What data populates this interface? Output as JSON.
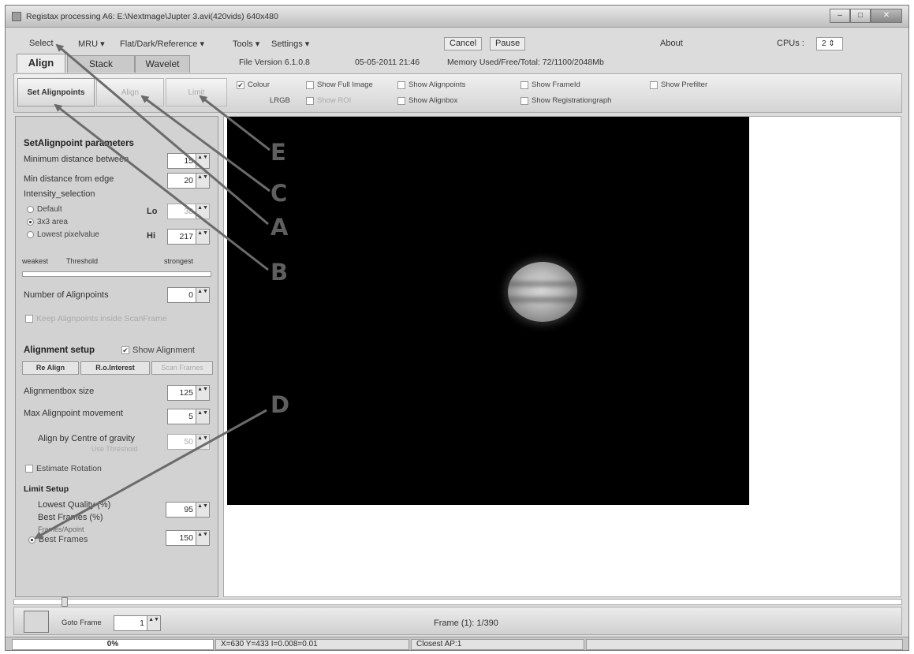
{
  "window": {
    "title": "Registax processing A6: E:\\Nextmage\\Jupter 3.avi(420vids) 640x480",
    "min": "–",
    "max": "□",
    "close": "✕"
  },
  "menu": {
    "select": "Select",
    "mru": "MRU ▾",
    "flat": "Flat/Dark/Reference ▾",
    "tools": "Tools ▾",
    "settings": "Settings ▾",
    "cancel": "Cancel",
    "pause": "Pause",
    "about": "About",
    "cpus_label": "CPUs :",
    "cpus_value": "2 ⇕"
  },
  "tabs": [
    "Align",
    "Stack",
    "Wavelet"
  ],
  "info": {
    "version": "File Version 6.1.0.8",
    "date": "05-05-2011 21:46",
    "memory": "Memory Used/Free/Total: 72/1100/2048Mb"
  },
  "toolbar": {
    "set_alignpoints": "Set Alignpoints",
    "align": "Align",
    "limit": "Limit",
    "colour": "Colour",
    "lrgb": "LRGB",
    "show_full_image": "Show Full Image",
    "show_roi": "Show ROI",
    "show_alignpoints": "Show Alignpoints",
    "show_alignbox": "Show Alignbox",
    "show_frameid": "Show FrameId",
    "show_registration_graph": "Show Registrationgraph",
    "show_prefilter": "Show Prefilter",
    "check": "✔"
  },
  "left": {
    "params_header": "SetAlignpoint parameters",
    "min_distance_label": "Minimum distance between",
    "min_distance_value": "15",
    "min_edge_label": "Min distance from edge",
    "min_edge_value": "20",
    "intensity_label": "Intensity_selection",
    "default": "Default",
    "area": "3x3 area",
    "lowest": "Lowest pixelvalue",
    "lo_label": "Lo",
    "lo_value": "38",
    "hi_label": "Hi",
    "hi_value": "217",
    "weakest": "weakest",
    "threshold": "Threshold",
    "strongest": "strongest",
    "num_ap_label": "Number of Alignpoints",
    "num_ap_value": "0",
    "keep_ap": "Keep Alignpoints inside ScanFrame",
    "align_header": "Alignment setup",
    "show_alignment": "Show Alignment",
    "re_align": "Re Align",
    "roi": "R.o.Interest",
    "scan_frames": "Scan Frames",
    "alignbox_label": "Alignmentbox size",
    "alignbox_value": "125",
    "max_move_label": "Max Alignpoint movement",
    "max_move_value": "5",
    "centre_label": "Align by Centre of gravity",
    "centre_value": "50",
    "centre_sub": "Use Threshold",
    "estimate_rotation": "Estimate Rotation",
    "limit_header": "Limit Setup",
    "lowest_quality": "Lowest Quality (%)",
    "best_frames_pct": "Best Frames (%)",
    "frames_ap": "Frames/Apoint",
    "best_frames": "Best Frames",
    "val_95": "95",
    "val_150": "150",
    "arrows": "▲▼",
    "check": "✔"
  },
  "bottom": {
    "goto_label": "Goto Frame",
    "goto_value": "1",
    "frame_text": "Frame (1): 1/390"
  },
  "status": {
    "progress": "0%",
    "coords": "X=630 Y=433 I=0.008=0.01",
    "closest": "Closest AP:1"
  },
  "callouts": [
    "E",
    "C",
    "A",
    "B",
    "D"
  ],
  "colors": {
    "arrow": "#6b6b6b",
    "image_bg": "#000000"
  }
}
